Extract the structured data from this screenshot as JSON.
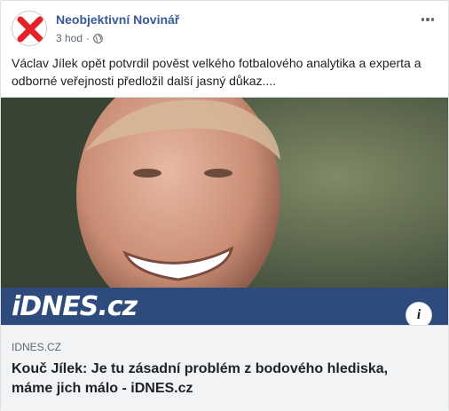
{
  "post": {
    "page_name": "Neobjektivní Novinář",
    "timestamp": "3 hod",
    "privacy_icon": "globe-icon",
    "more_icon": "more-options-icon",
    "text": "Václav Jílek opět potvrdil pověst velkého fotbalového analytika a experta a odborné veřejnosti předložil další jasný důkaz...."
  },
  "link_preview": {
    "image_logo": "iDNES.cz",
    "info_icon": "info-icon",
    "domain": "IDNES.CZ",
    "title": "Kouč Jílek: Je tu zásadní problém z bodového hlediska, máme jich málo - iDNES.cz"
  },
  "colors": {
    "page_name": "#385898",
    "idnes_banner": "#2e4b7e",
    "card_bg": "#f2f3f5",
    "avatar_cross": "#e32227"
  }
}
